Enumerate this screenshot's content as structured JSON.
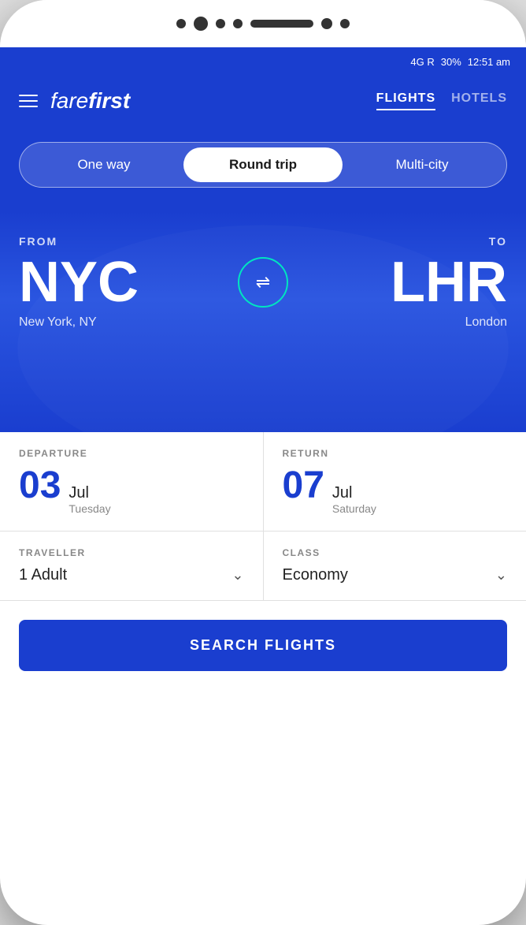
{
  "status_bar": {
    "signal": "4G R",
    "battery": "30%",
    "time": "12:51 am"
  },
  "header": {
    "brand": "farefirst",
    "nav": {
      "flights": "FLIGHTS",
      "hotels": "HOTELS"
    },
    "hamburger_label": "menu"
  },
  "trip_selector": {
    "options": [
      "One way",
      "Round trip",
      "Multi-city"
    ],
    "active": "Round trip"
  },
  "route": {
    "from_label": "FROM",
    "from_code": "NYC",
    "from_city": "New York, NY",
    "to_label": "TO",
    "to_code": "LHR",
    "to_city": "London",
    "swap_icon": "⇌"
  },
  "departure": {
    "label": "DEPARTURE",
    "day": "03",
    "month": "Jul",
    "weekday": "Tuesday"
  },
  "return": {
    "label": "RETURN",
    "day": "07",
    "month": "Jul",
    "weekday": "Saturday"
  },
  "traveller": {
    "label": "TRAVELLER",
    "value": "1 Adult"
  },
  "class": {
    "label": "CLASS",
    "value": "Economy"
  },
  "search_button": {
    "label": "SEARCH FLIGHTS"
  }
}
